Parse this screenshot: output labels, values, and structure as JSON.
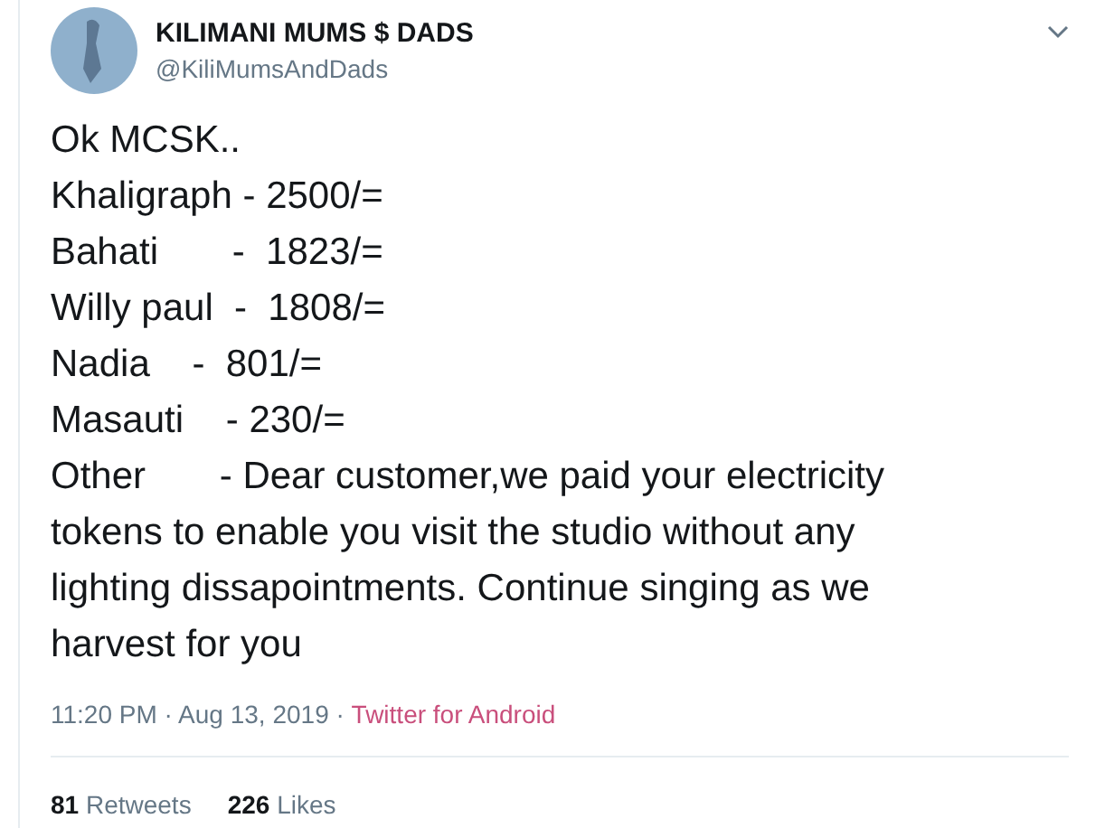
{
  "author": {
    "name": "KILIMANI MUMS $ DADS",
    "handle": "@KiliMumsAndDads"
  },
  "body_lines": [
    "Ok MCSK..",
    "Khaligraph - 2500/=",
    "Bahati       -  1823/=",
    "Willy paul  -  1808/=",
    "Nadia    -  801/=",
    "Masauti    - 230/=",
    "Other       - Dear customer,we paid your electricity",
    "tokens to enable you visit the studio without any",
    "lighting dissapointments. Continue singing as we",
    "harvest for you"
  ],
  "meta": {
    "time": "11:20 PM · Aug 13, 2019 · ",
    "source": "Twitter for Android"
  },
  "stats": [
    "**81** Retweets",
    "**226** Likes"
  ]
}
